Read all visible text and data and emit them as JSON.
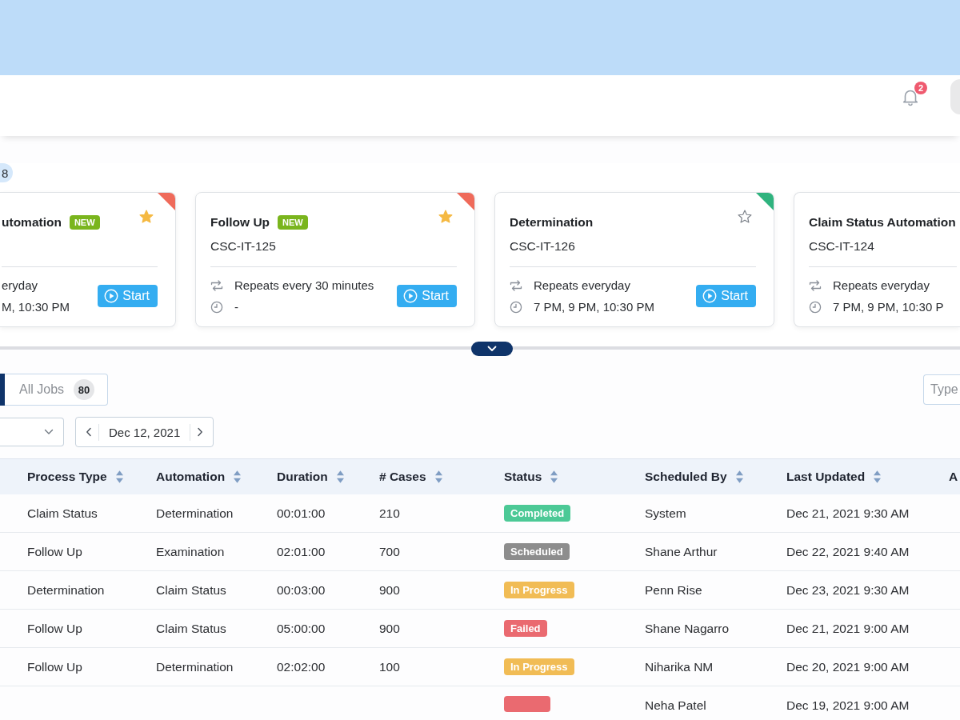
{
  "notifications": {
    "count": "2"
  },
  "panel": {
    "count": "8"
  },
  "cards": [
    {
      "kind": "tail",
      "title": "utomation",
      "badge": "NEW",
      "favorite": true,
      "color": "#ef6a5a",
      "repeat": "eryday",
      "times": "M, 10:30 PM",
      "button": "Start"
    },
    {
      "kind": "full",
      "title": "Follow Up",
      "badge": "NEW",
      "favorite": true,
      "color": "#ef6a5a",
      "code": "CSC-IT-125",
      "repeat": "Repeats every 30 minutes",
      "times": "-",
      "button": "Start"
    },
    {
      "kind": "full",
      "title": "Determination",
      "favorite": false,
      "color": "#2fb37e",
      "code": "CSC-IT-126",
      "repeat": "Repeats everyday",
      "times": "7 PM, 9 PM, 10:30 PM",
      "button": "Start"
    },
    {
      "kind": "head",
      "title": "Claim Status Automation",
      "code": "CSC-IT-124",
      "repeat": "Repeats everyday",
      "times": "7 PM, 9 PM, 10:30 P"
    }
  ],
  "tabs": [
    {
      "selected": true
    },
    {
      "label": "All Jobs",
      "count": "80",
      "selected": false
    }
  ],
  "search": {
    "placeholder": "Type"
  },
  "date_picker": {
    "value": "Dec 12, 2021"
  },
  "table": {
    "columns": [
      "Process Type",
      "Automation",
      "Duration",
      "# Cases",
      "Status",
      "Scheduled By",
      "Last Updated"
    ],
    "partial_column": "A",
    "rows": [
      {
        "process_type": "Claim Status",
        "automation": "Determination",
        "duration": "00:01:00",
        "cases": "210",
        "status": {
          "label": "Completed",
          "color": "#4cc996"
        },
        "scheduled_by": "System",
        "last_updated": "Dec 21, 2021 9:30 AM"
      },
      {
        "process_type": "Follow Up",
        "automation": "Examination",
        "duration": "02:01:00",
        "cases": "700",
        "status": {
          "label": "Scheduled",
          "color": "#8d8d8d"
        },
        "scheduled_by": "Shane Arthur",
        "last_updated": "Dec 22, 2021 9:40 AM"
      },
      {
        "process_type": "Determination",
        "automation": "Claim Status",
        "duration": "00:03:00",
        "cases": "900",
        "status": {
          "label": "In Progress",
          "color": "#f1bc55"
        },
        "scheduled_by": "Penn Rise",
        "last_updated": "Dec 23, 2021 9:30 AM"
      },
      {
        "process_type": "Follow Up",
        "automation": "Claim Status",
        "duration": "05:00:00",
        "cases": "900",
        "status": {
          "label": "Failed",
          "color": "#ea6a70"
        },
        "scheduled_by": "Shane Nagarro",
        "last_updated": "Dec 21, 2021 9:00 AM"
      },
      {
        "process_type": "Follow Up",
        "automation": "Determination",
        "duration": "02:02:00",
        "cases": "100",
        "status": {
          "label": "In Progress",
          "color": "#f1bc55"
        },
        "scheduled_by": "Niharika NM",
        "last_updated": "Dec 20, 2021 9:00 AM"
      },
      {
        "status": {
          "color": "#ea6a70"
        },
        "scheduled_by": "Neha Patel",
        "last_updated": "Dec 19, 2021 9:00 AM"
      }
    ]
  }
}
